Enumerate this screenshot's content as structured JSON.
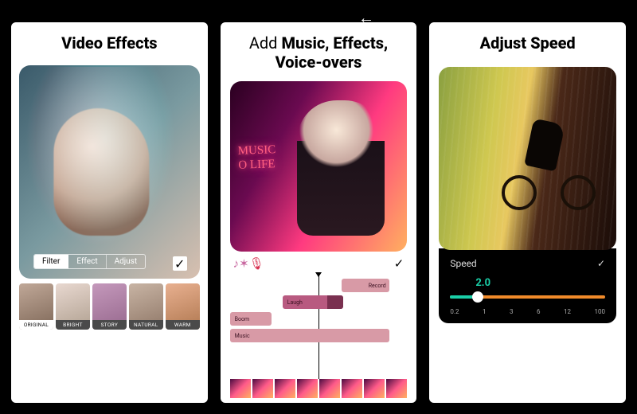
{
  "nav": {
    "back_icon": "←"
  },
  "panel1": {
    "title": "Video Effects",
    "tabs": {
      "filter": "Filter",
      "effect": "Effect",
      "adjust": "Adjust",
      "selected": "filter"
    },
    "confirm": "✓",
    "filter_thumbs": [
      {
        "label": "ORIGINAL",
        "className": "f-original",
        "selected": true
      },
      {
        "label": "BRIGHT",
        "className": "f-bright"
      },
      {
        "label": "STORY",
        "className": "f-story"
      },
      {
        "label": "NATURAL",
        "className": "f-natural"
      },
      {
        "label": "WARM",
        "className": "f-warm"
      }
    ]
  },
  "panel2": {
    "title_light": "Add ",
    "title_bold": "Music, Effects, Voice-overs",
    "neon_line1": "MUSIC",
    "neon_line2": "O LIFE",
    "toolbar": {
      "music": "♪",
      "fx": "✶",
      "mic": "🎙",
      "ok": "✓"
    },
    "tracks": {
      "record": "Record",
      "laugh": "Laugh",
      "boom": "Boom",
      "music": "Music"
    }
  },
  "panel3": {
    "title": "Adjust Speed",
    "label": "Speed",
    "ok": "✓",
    "value": "2.0",
    "ticks": [
      "0.2",
      "1",
      "3",
      "6",
      "12",
      "100"
    ],
    "slider_percent": 18
  }
}
